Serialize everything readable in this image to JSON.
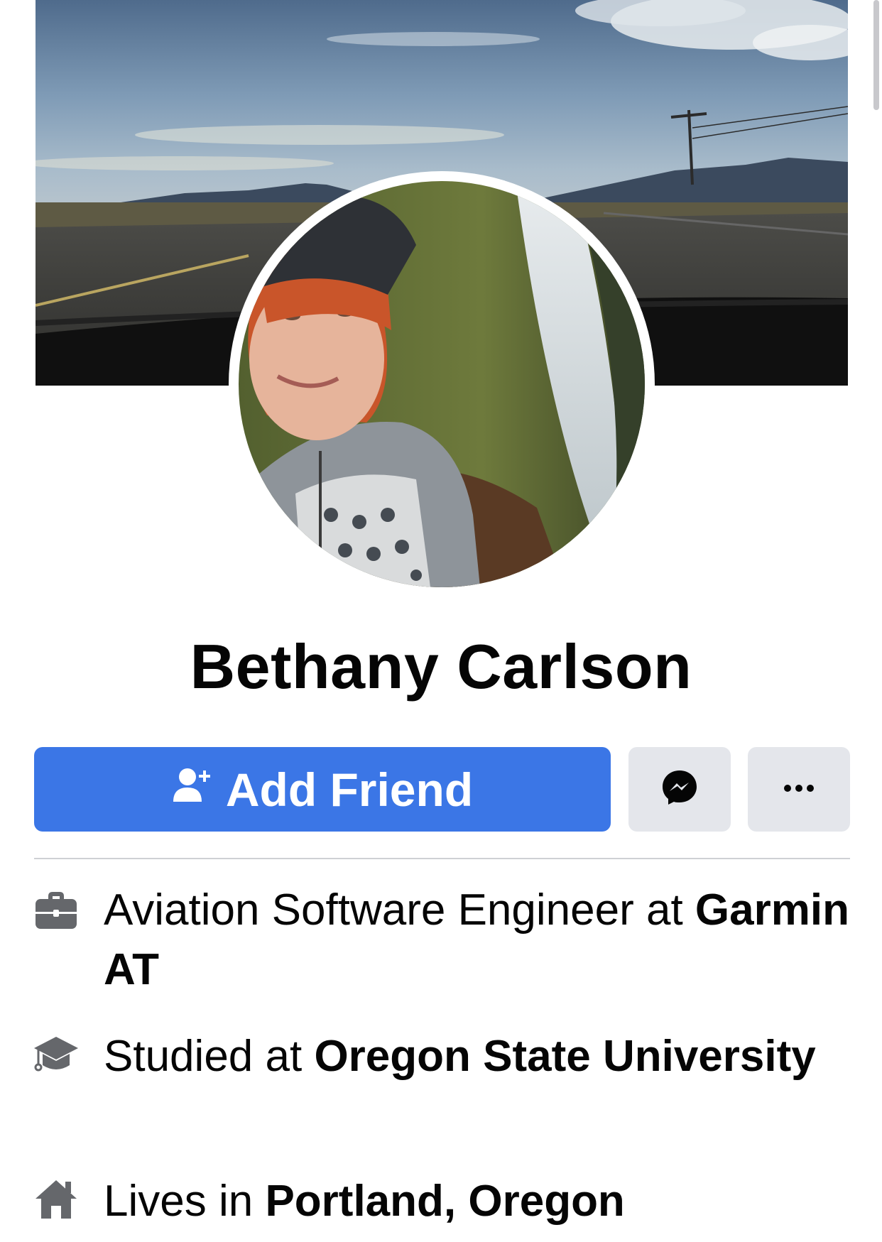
{
  "profile": {
    "name": "Bethany Carlson"
  },
  "actions": {
    "add_friend_label": "Add Friend",
    "add_friend_icon": "add-person-icon",
    "message_icon": "messenger-icon",
    "more_icon": "more-dots-icon"
  },
  "details": {
    "work": {
      "icon": "briefcase-icon",
      "prefix": "Aviation Software Engineer at ",
      "value": "Garmin AT"
    },
    "education": {
      "icon": "graduation-cap-icon",
      "prefix": "Studied at ",
      "value": "Oregon State University"
    },
    "residence": {
      "icon": "home-icon",
      "prefix": "Lives in ",
      "value": "Portland, Oregon"
    }
  },
  "colors": {
    "primary_button": "#3b76e6",
    "secondary_button": "#e4e6eb",
    "text": "#050505",
    "divider": "#ced0d4"
  }
}
